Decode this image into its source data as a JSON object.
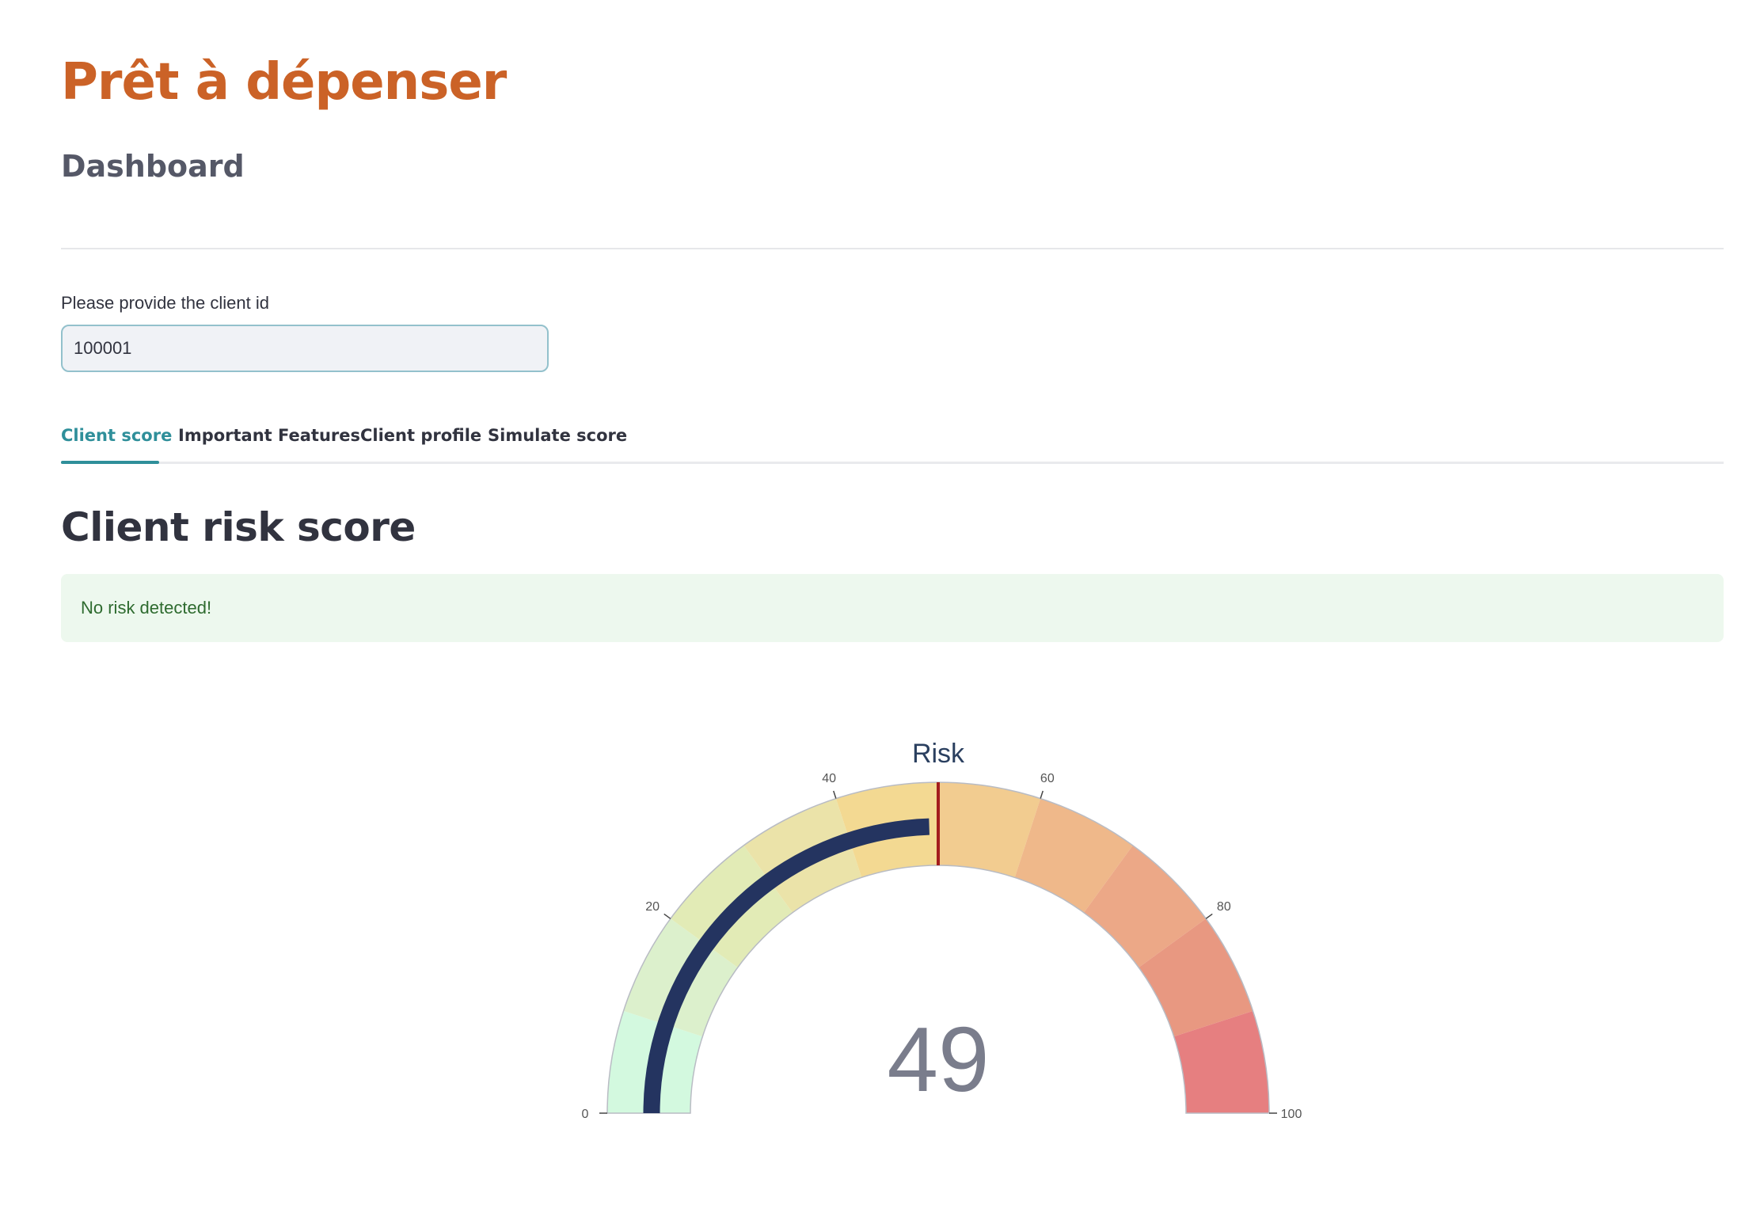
{
  "header": {
    "app_title": "Prêt à dépenser",
    "subtitle": "Dashboard"
  },
  "client_input": {
    "label": "Please provide the client id",
    "value": "100001"
  },
  "tabs": [
    {
      "label": "Client score",
      "active": true
    },
    {
      "label": "Important Features",
      "active": false
    },
    {
      "label": "Client profile",
      "active": false
    },
    {
      "label": "Simulate score",
      "active": false
    }
  ],
  "section": {
    "title": "Client risk score"
  },
  "alert": {
    "message": "No risk detected!",
    "color": "#2e6b2f",
    "background": "#edf8ee"
  },
  "colors": {
    "brand": "#cb6227",
    "tab_active": "#2f8f9a",
    "gauge_bar": "#243460",
    "threshold": "#a31d1d"
  },
  "chart_data": {
    "type": "gauge",
    "title": "Risk",
    "value": 49,
    "range": [
      0,
      100
    ],
    "ticks": [
      "0",
      "20",
      "40",
      "60",
      "80",
      "100"
    ],
    "threshold": 50,
    "bands": [
      {
        "from": 0,
        "to": 10,
        "color": "#d3f9df"
      },
      {
        "from": 10,
        "to": 20,
        "color": "#dcf0cc"
      },
      {
        "from": 20,
        "to": 30,
        "color": "#e2ebb6"
      },
      {
        "from": 30,
        "to": 40,
        "color": "#ebe3a9"
      },
      {
        "from": 40,
        "to": 50,
        "color": "#f3d992"
      },
      {
        "from": 50,
        "to": 60,
        "color": "#f2cc90"
      },
      {
        "from": 60,
        "to": 70,
        "color": "#efb88a"
      },
      {
        "from": 70,
        "to": 80,
        "color": "#eca887"
      },
      {
        "from": 80,
        "to": 90,
        "color": "#e89881"
      },
      {
        "from": 90,
        "to": 100,
        "color": "#e67f80"
      }
    ]
  }
}
